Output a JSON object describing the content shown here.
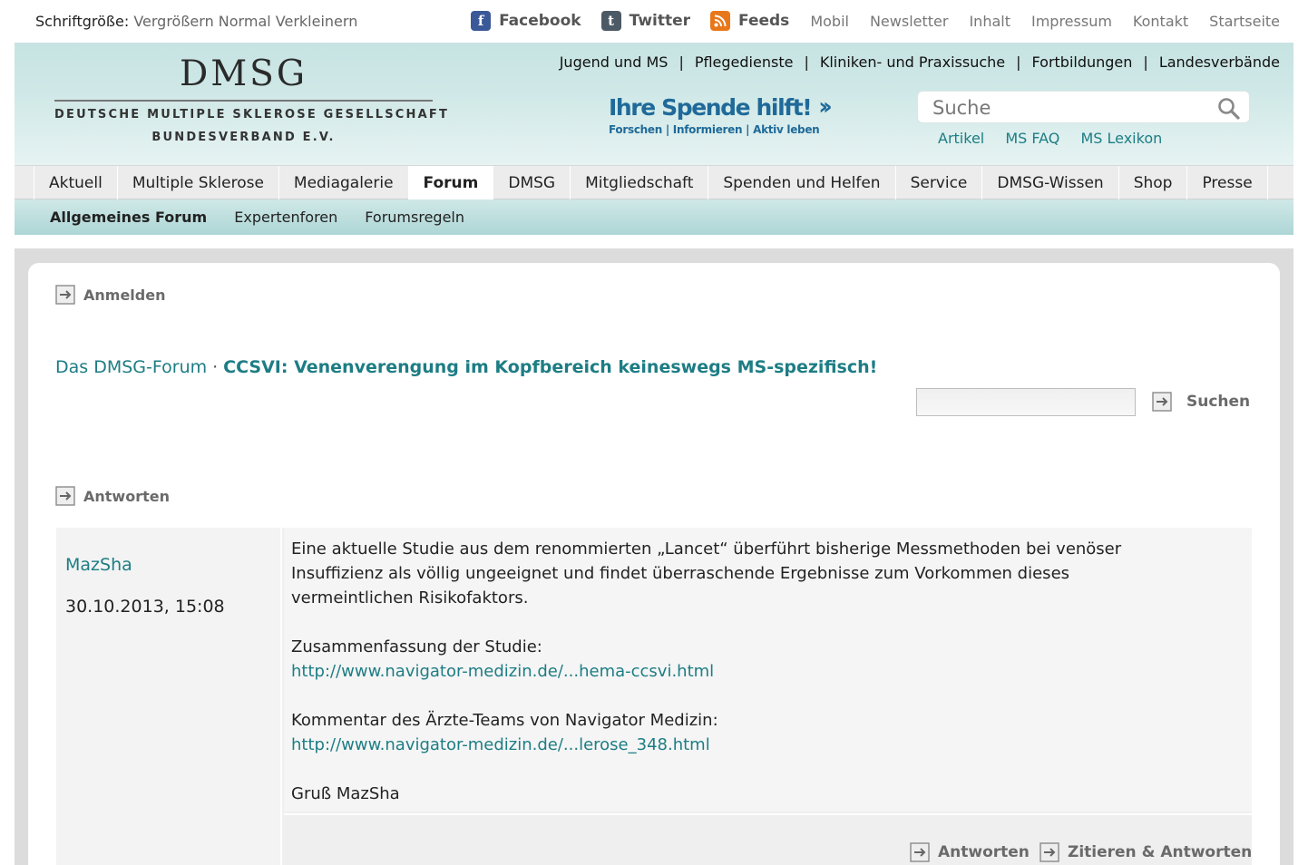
{
  "topbar": {
    "fontsize_label": "Schriftgröße:",
    "fontsize_options": [
      "Vergrößern",
      "Normal",
      "Verkleinern"
    ],
    "social": [
      {
        "label": "Facebook",
        "icon": "facebook-icon"
      },
      {
        "label": "Twitter",
        "icon": "twitter-icon"
      },
      {
        "label": "Feeds",
        "icon": "rss-feed-icon"
      }
    ],
    "links": [
      "Mobil",
      "Newsletter",
      "Inhalt",
      "Impressum",
      "Kontakt",
      "Startseite"
    ]
  },
  "header": {
    "logo_title": "DMSG",
    "logo_line1": "DEUTSCHE MULTIPLE SKLEROSE GESELLSCHAFT",
    "logo_line2": "BUNDESVERBAND E.V.",
    "donate_headline": "Ihre Spende hilft!",
    "donate_tagline": "Forschen | Informieren | Aktiv leben",
    "sublinks": [
      "Jugend und MS",
      "Pflegedienste",
      "Kliniken- und Praxissuche",
      "Fortbildungen",
      "Landesverbände"
    ],
    "search_placeholder": "Suche",
    "quicklinks": [
      "Artikel",
      "MS FAQ",
      "MS Lexikon"
    ]
  },
  "mainnav": {
    "items": [
      "Aktuell",
      "Multiple Sklerose",
      "Mediagalerie",
      "Forum",
      "DMSG",
      "Mitgliedschaft",
      "Spenden und Helfen",
      "Service",
      "DMSG-Wissen",
      "Shop",
      "Presse"
    ],
    "active": "Forum"
  },
  "subnav": {
    "items": [
      "Allgemeines Forum",
      "Expertenforen",
      "Forumsregeln"
    ],
    "active": "Allgemeines Forum"
  },
  "forum": {
    "login_label": "Anmelden",
    "breadcrumb_root": "Das DMSG-Forum",
    "breadcrumb_separator": "·",
    "thread_title": "CCSVI: Venenverengung im Kopfbereich keineswegs MS-spezifisch!",
    "search_button": "Suchen",
    "reply_label": "Antworten"
  },
  "post": {
    "author": "MazSha",
    "date": "30.10.2013, 15:08",
    "intro_line1": "Eine aktuelle Studie aus dem renommierten „Lancet“ überführt bisherige Messmethoden bei venöser",
    "intro_line2": "Insuffizienz als völlig ungeeignet und findet überraschende Ergebnisse zum Vorkommen dieses",
    "intro_line3": "vermeintlichen Risikofaktors.",
    "summary_label": "Zusammenfassung der Studie:",
    "summary_link": "http://www.navigator-medizin.de/...hema-ccsvi.html",
    "comment_label": "Kommentar des Ärzte-Teams von Navigator Medizin:",
    "comment_link": "http://www.navigator-medizin.de/...lerose_348.html",
    "signature": "Gruß MazSha",
    "reply_button": "Antworten",
    "quote_button": "Zitieren & Antworten"
  },
  "colors": {
    "teal_link": "#1d7d84",
    "header_bg": "#c6e3e2",
    "donate_blue": "#1f6a99",
    "nav_bg": "#ececec"
  }
}
